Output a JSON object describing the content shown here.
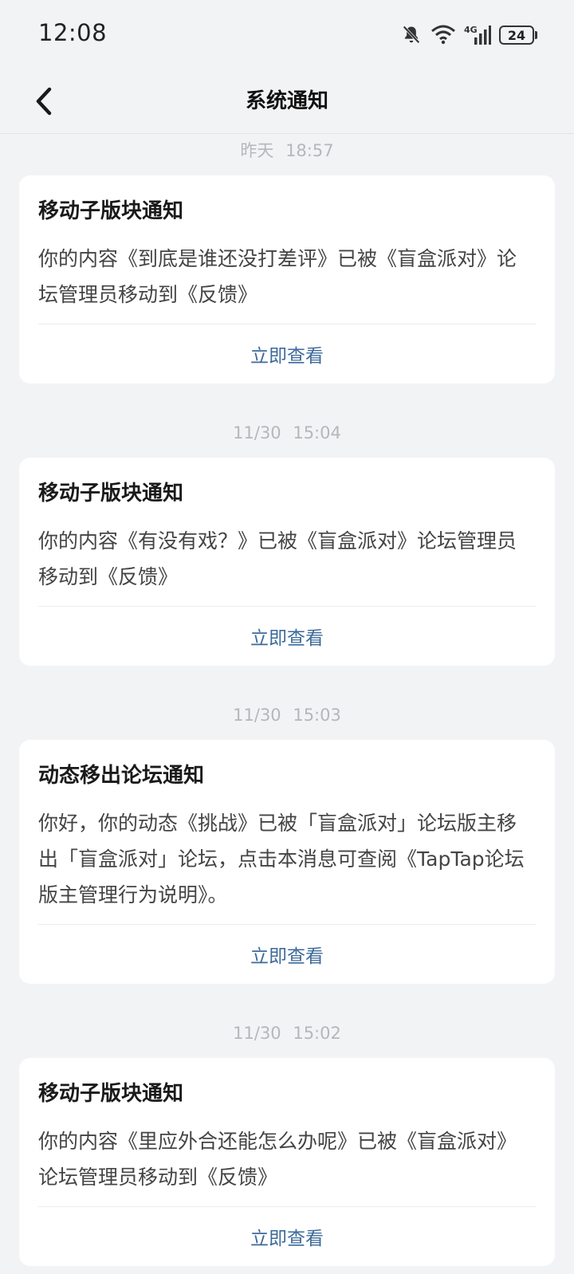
{
  "status_bar": {
    "time": "12:08",
    "network": "4G",
    "battery": "24",
    "icons": [
      "bell-muted-icon",
      "wifi-icon",
      "signal-icon",
      "battery-icon"
    ]
  },
  "nav": {
    "title": "系统通知",
    "back_icon": "chevron-left-icon"
  },
  "notifications": [
    {
      "time": "昨天 18:57",
      "title": "移动子版块通知",
      "body": "你的内容《到底是谁还没打差评》已被《盲盒派对》论坛管理员移动到《反馈》",
      "action": "立即查看"
    },
    {
      "time": "11/30 15:04",
      "title": "移动子版块通知",
      "body": "你的内容《有没有戏？》已被《盲盒派对》论坛管理员移动到《反馈》",
      "action": "立即查看"
    },
    {
      "time": "11/30 15:03",
      "title": "动态移出论坛通知",
      "body": "你好，你的动态《挑战》已被「盲盒派对」论坛版主移出「盲盒派对」论坛，点击本消息可查阅《TapTap论坛版主管理行为说明》。",
      "action": "立即查看"
    },
    {
      "time": "11/30 15:02",
      "title": "移动子版块通知",
      "body": "你的内容《里应外合还能怎么办呢》已被《盲盒派对》论坛管理员移动到《反馈》",
      "action": "立即查看"
    }
  ],
  "colors": {
    "background": "#f2f3f5",
    "card": "#ffffff",
    "action_link": "#3d6a9a",
    "timestamp": "#b5b7bb"
  }
}
